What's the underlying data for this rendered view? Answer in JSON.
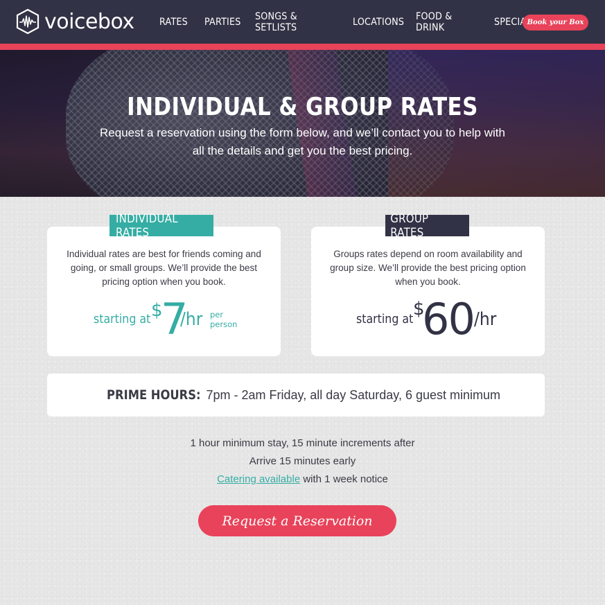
{
  "brand": {
    "name": "voicebox"
  },
  "nav": {
    "links": [
      "RATES",
      "PARTIES",
      "SONGS & SETLISTS",
      "LOCATIONS",
      "FOOD & DRINK",
      "SPECIALS"
    ],
    "cta": "Book your Box"
  },
  "hero": {
    "title": "INDIVIDUAL & GROUP RATES",
    "subtitle": "Request a reservation using the form below, and we’ll contact you to help with all the details and get you the best pricing."
  },
  "individual": {
    "tab": "INDIVIDUAL RATES",
    "description": "Individual rates are best for friends coming and going, or small groups. We’ll provide the best pricing option when you book.",
    "starting": "starting at",
    "currency": "$",
    "amount": "7",
    "unit": "/hr",
    "note_line1": "per",
    "note_line2": "person"
  },
  "group": {
    "tab": "GROUP RATES",
    "description": "Groups rates depend on room availability and group size. We’ll provide the best pricing option when you book.",
    "starting": "starting at",
    "currency": "$",
    "amount": "60",
    "unit": "/hr"
  },
  "prime": {
    "label": "PRIME HOURS:",
    "text": "7pm - 2am Friday, all day Saturday, 6 guest minimum"
  },
  "info": {
    "line1": "1 hour minimum stay, 15 minute increments after",
    "line2": "Arrive 15 minutes early",
    "catering_link": "Catering available",
    "line3_rest": " with 1 week notice"
  },
  "request_button": "Request a Reservation",
  "colors": {
    "nav_bg": "#323246",
    "accent_red": "#e8435a",
    "teal": "#35ada4",
    "text_dark": "#3a3a45"
  }
}
